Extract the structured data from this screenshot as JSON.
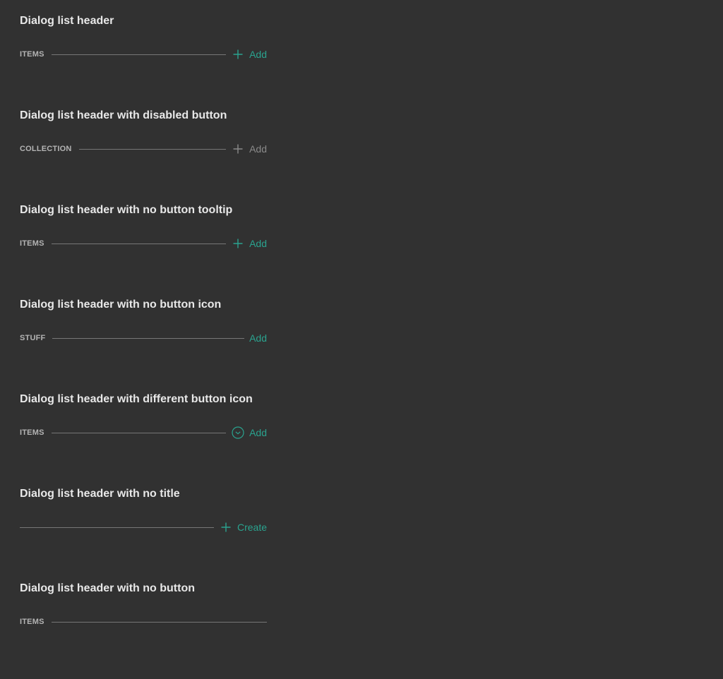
{
  "theme": {
    "background": "#313131",
    "accent": "#2aa38f",
    "disabled": "#8a8a8a",
    "rule": "#777777",
    "title": "#e8e8e8",
    "label": "#b4b4b4"
  },
  "demos": [
    {
      "title": "Dialog list header",
      "label": "ITEMS",
      "button": {
        "label": "Add",
        "icon": "plus-icon",
        "disabled": false
      }
    },
    {
      "title": "Dialog list header with disabled button",
      "label": "COLLECTION",
      "button": {
        "label": "Add",
        "icon": "plus-icon",
        "disabled": true
      }
    },
    {
      "title": "Dialog list header with no button tooltip",
      "label": "ITEMS",
      "button": {
        "label": "Add",
        "icon": "plus-icon",
        "disabled": false
      }
    },
    {
      "title": "Dialog list header with no button icon",
      "label": "STUFF",
      "button": {
        "label": "Add",
        "icon": null,
        "disabled": false
      }
    },
    {
      "title": "Dialog list header with different button icon",
      "label": "ITEMS",
      "button": {
        "label": "Add",
        "icon": "circle-chevron-down-icon",
        "disabled": false
      }
    },
    {
      "title": "Dialog list header with no title",
      "label": "",
      "button": {
        "label": "Create",
        "icon": "plus-icon",
        "disabled": false
      }
    },
    {
      "title": "Dialog list header with no button",
      "label": "ITEMS",
      "button": null
    }
  ]
}
